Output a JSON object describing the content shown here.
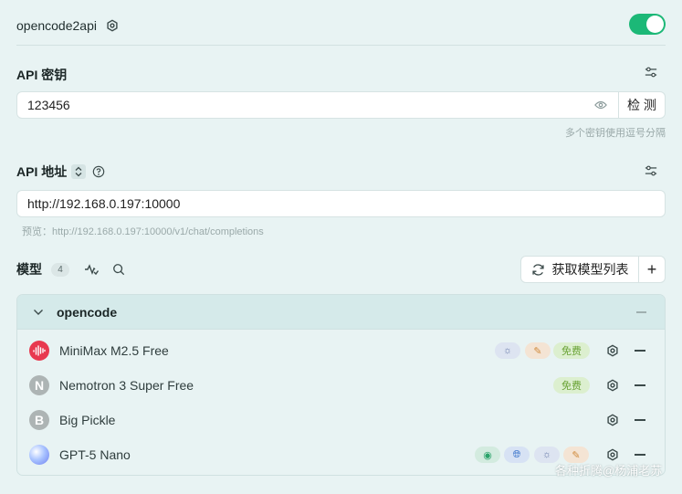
{
  "provider": {
    "name": "opencode2api",
    "enabled": true
  },
  "api_key": {
    "label": "API 密钥",
    "value": "123456",
    "check_label": "检 测",
    "hint": "多个密钥使用逗号分隔"
  },
  "api_address": {
    "label": "API 地址",
    "value": "http://192.168.0.197:10000",
    "preview": "预览：http://192.168.0.197:10000/v1/chat/completions"
  },
  "models": {
    "label": "模型",
    "count": "4",
    "fetch_label": "获取模型列表",
    "group": {
      "name": "opencode",
      "items": [
        {
          "name": "MiniMax M2.5 Free",
          "tags": [
            "reasoning",
            "tool",
            "免费"
          ]
        },
        {
          "name": "Nemotron 3 Super Free",
          "avatar_letter": "N",
          "tags": [
            "免费"
          ]
        },
        {
          "name": "Big Pickle",
          "avatar_letter": "B",
          "tags": []
        },
        {
          "name": "GPT-5 Nano",
          "tags": [
            "vision",
            "web",
            "reasoning",
            "tool"
          ]
        }
      ]
    }
  },
  "free_tag": "免费",
  "watermark": "各种折腾@杨浦老苏",
  "colors": {
    "accent": "#1cb877",
    "background": "#e8f3f3",
    "minimax": "#e8394f"
  }
}
